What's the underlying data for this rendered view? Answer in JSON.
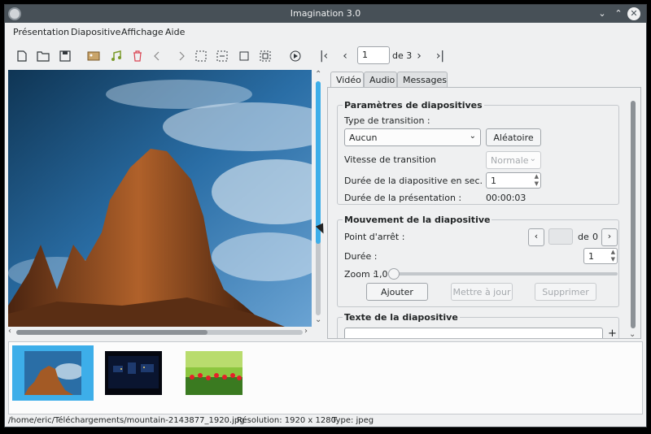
{
  "window": {
    "title": "Imagination 3.0"
  },
  "menubar": [
    "Présentation",
    "Diapositive",
    "Affichage",
    "Aide"
  ],
  "toolbar": {
    "page_value": "1",
    "page_of": "de 3"
  },
  "tabs": [
    "Vidéo",
    "Audio",
    "Messages"
  ],
  "slide_settings": {
    "title": "Paramètres de diapositives",
    "transition_type_label": "Type de transition :",
    "transition_value": "Aucun",
    "random_button": "Aléatoire",
    "transition_speed_label": "Vitesse de transition",
    "transition_speed_value": "Normale",
    "slide_duration_label": "Durée de la diapositive en sec. :",
    "slide_duration_value": "1",
    "presentation_duration_label": "Durée de la présentation :",
    "presentation_duration_value": "00:00:03"
  },
  "slide_motion": {
    "title": "Mouvement de la diapositive",
    "stop_point_label": "Point d'arrêt :",
    "stop_of": "de",
    "stop_total": "0",
    "duration_label": "Durée :",
    "duration_value": "1",
    "zoom_label": "Zoom :",
    "zoom_value": "1,0",
    "add_button": "Ajouter",
    "update_button": "Mettre à jour",
    "delete_button": "Supprimer"
  },
  "slide_text": {
    "title": "Texte de la diapositive"
  },
  "status": {
    "path": "/home/eric/Téléchargements/mountain-2143877_1920.jpg",
    "resolution": "Résolution: 1920 x 1280",
    "type": "Type: jpeg"
  },
  "colors": {
    "accent": "#3daee9",
    "titlebar": "#475057"
  }
}
